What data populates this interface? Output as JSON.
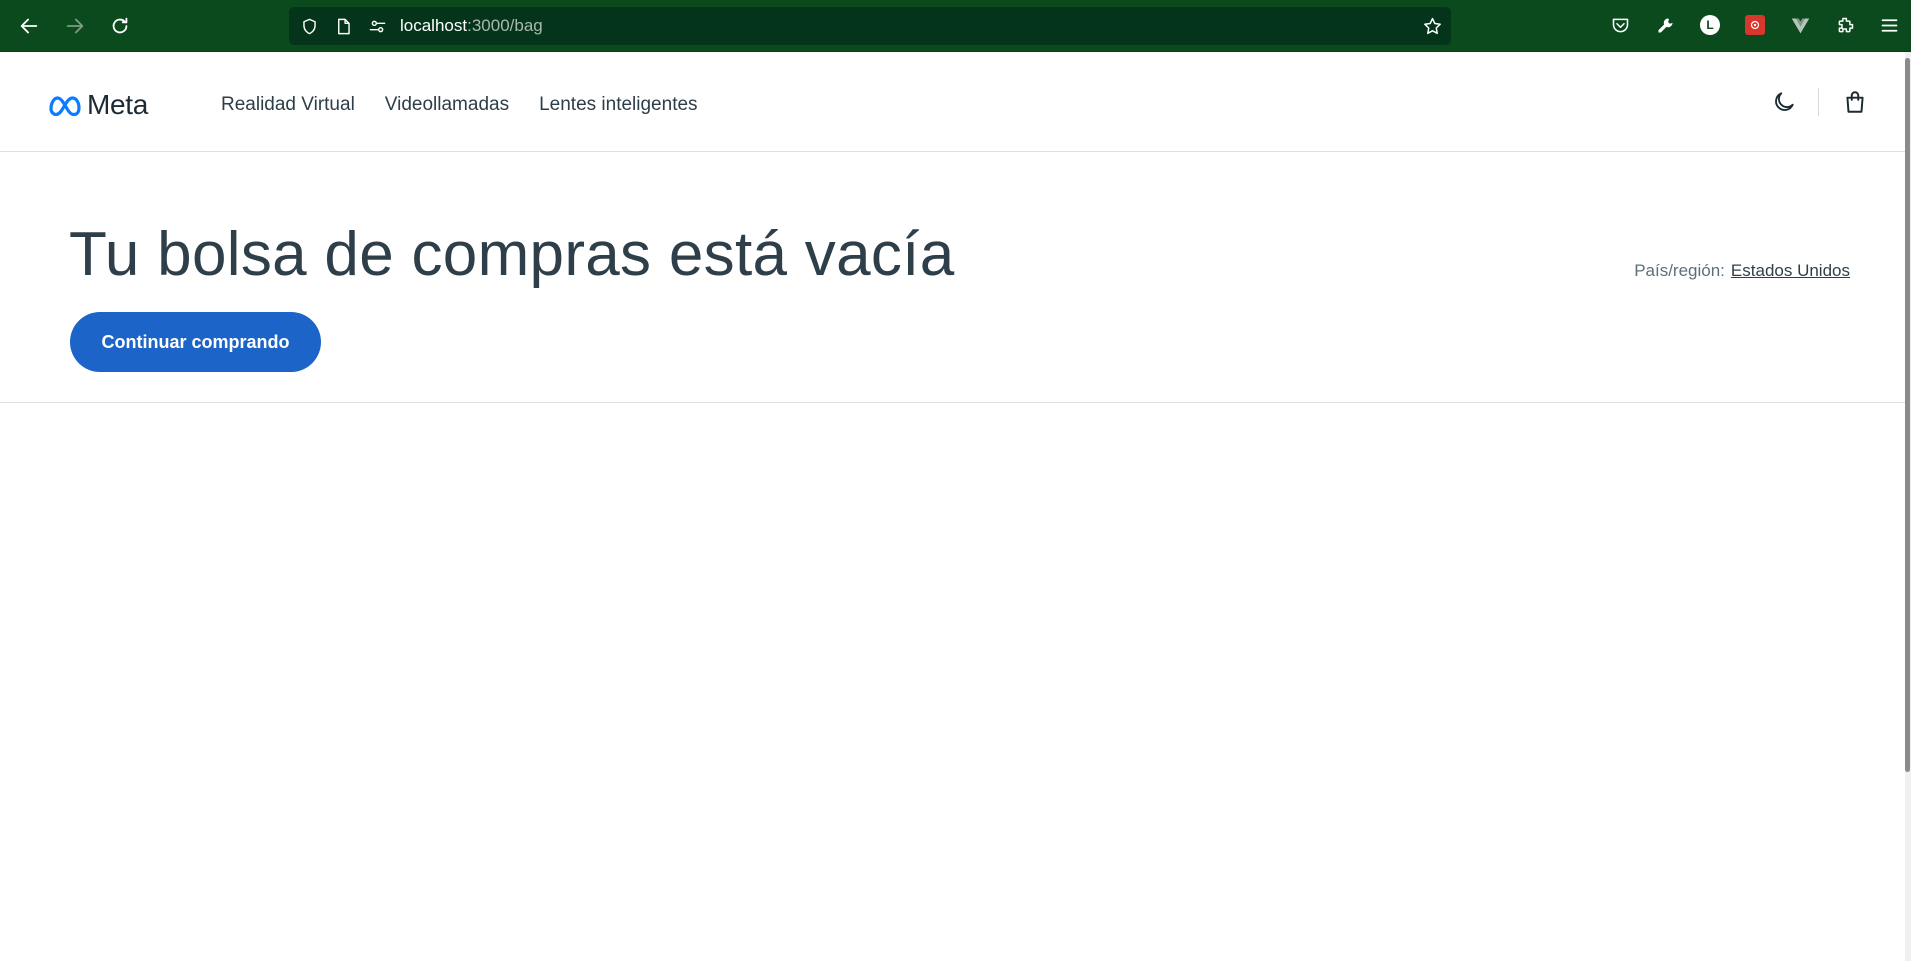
{
  "browser": {
    "url_host": "localhost",
    "url_path": ":3000/bag",
    "avatar_letter": "L",
    "colors": {
      "chrome_bg": "#0b4a1d",
      "url_bg": "#04341a"
    }
  },
  "header": {
    "logo_text": "Meta",
    "nav": [
      "Realidad Virtual",
      "Videollamadas",
      "Lentes inteligentes"
    ]
  },
  "main": {
    "title": "Tu bolsa de compras está vacía",
    "continue_label": "Continuar comprando",
    "region_label": "País/región:",
    "region_value": "Estados Unidos"
  },
  "colors": {
    "accent": "#1d64c8",
    "text": "#1c2b33"
  }
}
